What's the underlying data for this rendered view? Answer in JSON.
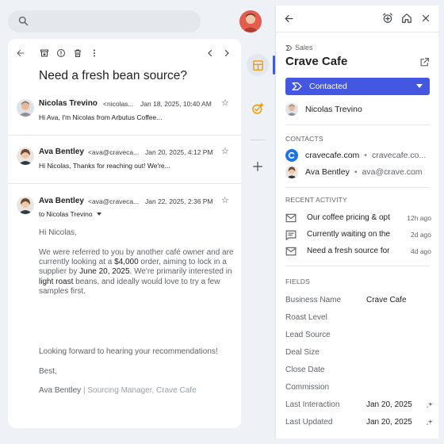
{
  "mail": {
    "subject": "Need a fresh bean source?",
    "messages": [
      {
        "from": "Nicolas Trevino",
        "address": "<nicolas...",
        "date": "Jan 18, 2025, 10:40 AM",
        "snippet": "Hi Ava, I'm Nicolas from Arbutus Coffee..."
      },
      {
        "from": "Ava Bentley",
        "address": "<ava@craveca...",
        "date": "Jan 20, 2025, 4:12 PM",
        "snippet": "Hi Nicolas, Thanks for reaching out! We're..."
      },
      {
        "from": "Ava Bentley",
        "address": "<ava@craveca...",
        "date": "Jan 22, 2025, 2:36 PM",
        "to": "to Nicolas Trevino",
        "greeting": "Hi Nicolas,",
        "p1_a": "We were referred to you by another café owner and are currently looking at a ",
        "p1_amount": "$4,000",
        "p1_b": " order, aiming to lock in a supplier by ",
        "p1_date": "June 20, 2025",
        "p1_c": ". We're primarily interested in ",
        "p1_product": "light roast",
        "p1_d": " beans, and ideally would love to try a few samples first.",
        "p2": "Looking forward to hearing your recommendations!",
        "closing": "Best,",
        "sig_name": "Ava Bentley",
        "sig_title": " | Sourcing Manager, Crave Cafe"
      }
    ]
  },
  "panel": {
    "breadcrumb": "Sales",
    "company": "Crave Cafe",
    "status": "Contacted",
    "owner": "Nicolas Trevino",
    "contacts_title": "CONTACTS",
    "contacts": [
      {
        "name": "cravecafe.com",
        "detail": "cravecafe.co..."
      },
      {
        "name": "Ava Bentley",
        "detail": "ava@crave.com"
      }
    ],
    "activity_title": "RECENT ACTIVITY",
    "activity": [
      {
        "icon": "mail-icon",
        "text": "Our coffee pricing & opt",
        "time": "12h ago"
      },
      {
        "icon": "note-icon",
        "text": "Currently waiting on the",
        "time": "2d ago"
      },
      {
        "icon": "mail-icon",
        "text": "Need a fresh source for",
        "time": "4d ago"
      }
    ],
    "fields_title": "FIELDS",
    "fields": [
      {
        "label": "Business Name",
        "value": "Crave Cafe"
      },
      {
        "label": "Roast Level",
        "value": ""
      },
      {
        "label": "Lead Source",
        "value": ""
      },
      {
        "label": "Deal Size",
        "value": ""
      },
      {
        "label": "Close Date",
        "value": ""
      },
      {
        "label": "Commission",
        "value": ""
      },
      {
        "label": "Last Interaction",
        "value": "Jan 20, 2025"
      },
      {
        "label": "Last Updated",
        "value": "Jan 20, 2025"
      }
    ]
  },
  "colors": {
    "accent": "#4457e0",
    "reminder": "#f29900",
    "avatar_bg": "#f1c9b8"
  }
}
